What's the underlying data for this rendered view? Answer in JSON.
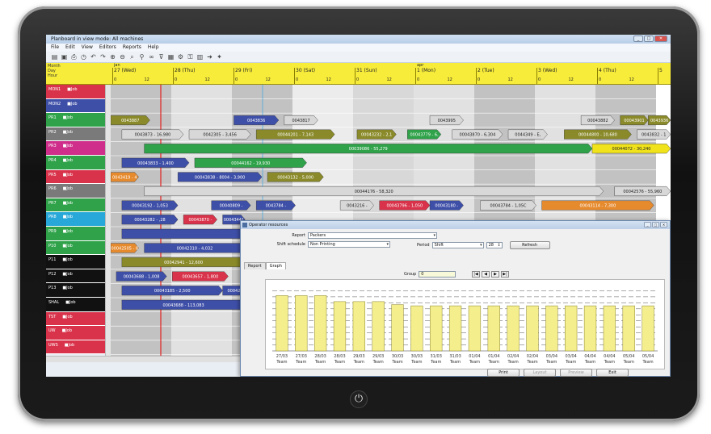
{
  "app": {
    "title": "Planboard in view mode: All machines",
    "menu": [
      "File",
      "Edit",
      "View",
      "Editors",
      "Reports",
      "Help"
    ],
    "power_icon": "power-icon"
  },
  "timeline": {
    "row_labels": [
      "Month",
      "Day",
      "Hour"
    ],
    "month_marks": [
      {
        "label": "jan"
      },
      {
        "label": "apr"
      }
    ],
    "days": [
      {
        "label": "27 (Wed)"
      },
      {
        "label": "28 (Thu)"
      },
      {
        "label": "29 (Fri)"
      },
      {
        "label": "30 (Sat)"
      },
      {
        "label": "31 (Sun)"
      },
      {
        "label": "1 (Mon)"
      },
      {
        "label": "2 (Tue)"
      },
      {
        "label": "3 (Wed)"
      },
      {
        "label": "4 (Thu)"
      },
      {
        "label": "5"
      }
    ],
    "hour_ticks": [
      "0",
      "12"
    ]
  },
  "machines": [
    {
      "name": "MON1",
      "job": "Job",
      "color": "#d9334b"
    },
    {
      "name": "MON2",
      "job": "Job",
      "color": "#3e4fa8"
    },
    {
      "name": "PR1",
      "job": "Job",
      "color": "#2fa24a"
    },
    {
      "name": "PR2",
      "job": "Job",
      "color": "#7a7a7a"
    },
    {
      "name": "PR3",
      "job": "Job",
      "color": "#cf2f8a"
    },
    {
      "name": "PR4",
      "job": "Job",
      "color": "#2fa24a"
    },
    {
      "name": "PR5",
      "job": "Job",
      "color": "#d9334b"
    },
    {
      "name": "PR6",
      "job": "Job",
      "color": "#7a7a7a"
    },
    {
      "name": "PR7",
      "job": "Job",
      "color": "#2fa24a"
    },
    {
      "name": "PR8",
      "job": "Job",
      "color": "#27a8d8"
    },
    {
      "name": "PR9",
      "job": "Job",
      "color": "#2fa24a"
    },
    {
      "name": "P10",
      "job": "Job",
      "color": "#2fa24a"
    },
    {
      "name": "P11",
      "job": "Job",
      "color": "#111111"
    },
    {
      "name": "P12",
      "job": "Job",
      "color": "#111111"
    },
    {
      "name": "P13",
      "job": "Job",
      "color": "#111111"
    },
    {
      "name": "SHAL",
      "job": "Job",
      "color": "#111111"
    },
    {
      "name": "TST",
      "job": "Job",
      "color": "#d9334b"
    },
    {
      "name": "UW",
      "job": "Job",
      "color": "#d9334b"
    },
    {
      "name": "UWS",
      "job": "Job",
      "color": "#d9334b"
    }
  ],
  "bars": [
    {
      "row": 2,
      "start": 0.0,
      "end": 0.07,
      "color": "#8a8a2a",
      "label": "0043887"
    },
    {
      "row": 2,
      "start": 0.22,
      "end": 0.3,
      "color": "#3e4fa8",
      "label": "0043836"
    },
    {
      "row": 2,
      "start": 0.31,
      "end": 0.37,
      "color": "#d8d8d8",
      "label": "0043817"
    },
    {
      "row": 2,
      "start": 0.57,
      "end": 0.63,
      "color": "#d8d8d8",
      "label": "0043995"
    },
    {
      "row": 2,
      "start": 0.84,
      "end": 0.9,
      "color": "#d8d8d8",
      "label": "00043882"
    },
    {
      "row": 2,
      "start": 0.91,
      "end": 0.96,
      "color": "#8a8a2a",
      "label": "00043901"
    },
    {
      "row": 2,
      "start": 0.96,
      "end": 1.0,
      "color": "#8a8a2a",
      "label": "0043936"
    },
    {
      "row": 3,
      "start": 0.02,
      "end": 0.13,
      "color": "#d8d8d8",
      "label": "0043873 - 16,980"
    },
    {
      "row": 3,
      "start": 0.14,
      "end": 0.25,
      "color": "#d8d8d8",
      "label": "0042305 - 3,456"
    },
    {
      "row": 3,
      "start": 0.26,
      "end": 0.4,
      "color": "#8a8a2a",
      "label": "00044201 - 7,143"
    },
    {
      "row": 3,
      "start": 0.44,
      "end": 0.51,
      "color": "#8a8a2a",
      "label": "00043232 - 2,1"
    },
    {
      "row": 3,
      "start": 0.53,
      "end": 0.59,
      "color": "#2fa24a",
      "label": "00043779 - 6,"
    },
    {
      "row": 3,
      "start": 0.61,
      "end": 0.7,
      "color": "#d8d8d8",
      "label": "00043870 - 6,304"
    },
    {
      "row": 3,
      "start": 0.71,
      "end": 0.78,
      "color": "#d8d8d8",
      "label": "0044349 - E,"
    },
    {
      "row": 3,
      "start": 0.81,
      "end": 0.93,
      "color": "#8a8a2a",
      "label": "00044800 - 10,680"
    },
    {
      "row": 3,
      "start": 0.94,
      "end": 1.0,
      "color": "#d8d8d8",
      "label": "0043832 - 1"
    },
    {
      "row": 4,
      "start": 0.06,
      "end": 0.86,
      "color": "#2fa24a",
      "label": "00039086 - 55,279"
    },
    {
      "row": 4,
      "start": 0.86,
      "end": 1.0,
      "color": "#f0e31c",
      "label": "00044072 - 30,240"
    },
    {
      "row": 5,
      "start": 0.02,
      "end": 0.14,
      "color": "#3e4fa8",
      "label": "00043833 - 1,400"
    },
    {
      "row": 5,
      "start": 0.15,
      "end": 0.35,
      "color": "#2fa24a",
      "label": "00044162 - 19,930"
    },
    {
      "row": 6,
      "start": 0.0,
      "end": 0.05,
      "color": "#e68a2e",
      "label": "0043419 - 4"
    },
    {
      "row": 6,
      "start": 0.12,
      "end": 0.27,
      "color": "#3e4fa8",
      "label": "00043838 - 8004 - 3,900"
    },
    {
      "row": 6,
      "start": 0.28,
      "end": 0.38,
      "color": "#8a8a2a",
      "label": "00043132 - 5,000"
    },
    {
      "row": 7,
      "start": 0.06,
      "end": 0.88,
      "color": "#d8d8d8",
      "label": "00044176 - 58,320"
    },
    {
      "row": 7,
      "start": 0.9,
      "end": 1.0,
      "color": "#d8d8d8",
      "label": "00042576 - 55,960"
    },
    {
      "row": 8,
      "start": 0.02,
      "end": 0.12,
      "color": "#3e4fa8",
      "label": "00043192 - 1,053"
    },
    {
      "row": 8,
      "start": 0.18,
      "end": 0.25,
      "color": "#3e4fa8",
      "label": "00040809 -"
    },
    {
      "row": 8,
      "start": 0.26,
      "end": 0.33,
      "color": "#3e4fa8",
      "label": "0043784 -"
    },
    {
      "row": 8,
      "start": 0.41,
      "end": 0.47,
      "color": "#d8d8d8",
      "label": "0043216 -"
    },
    {
      "row": 8,
      "start": 0.48,
      "end": 0.57,
      "color": "#d9334b",
      "label": "00043796 - 1,050"
    },
    {
      "row": 8,
      "start": 0.57,
      "end": 0.63,
      "color": "#3e4fa8",
      "label": "00043180 -"
    },
    {
      "row": 8,
      "start": 0.66,
      "end": 0.76,
      "color": "#d8d8d8",
      "label": "00043784 - 1,05C"
    },
    {
      "row": 8,
      "start": 0.77,
      "end": 0.97,
      "color": "#e68a2e",
      "label": "00043114 - 7,300"
    },
    {
      "row": 9,
      "start": 0.02,
      "end": 0.12,
      "color": "#3e4fa8",
      "label": "00043282 - ,28"
    },
    {
      "row": 9,
      "start": 0.13,
      "end": 0.19,
      "color": "#d9334b",
      "label": "00043870 -"
    },
    {
      "row": 9,
      "start": 0.2,
      "end": 0.24,
      "color": "#3e4fa8",
      "label": "00043441"
    },
    {
      "row": 10,
      "start": 0.02,
      "end": 0.24,
      "color": "#3e4fa8",
      "label": ""
    },
    {
      "row": 11,
      "start": 0.0,
      "end": 0.05,
      "color": "#e68a2e",
      "label": "00042505 - 8"
    },
    {
      "row": 11,
      "start": 0.06,
      "end": 0.24,
      "color": "#3e4fa8",
      "label": "00042310 - 4,032"
    },
    {
      "row": 12,
      "start": 0.02,
      "end": 0.24,
      "color": "#8a8a2a",
      "label": "00042941 - 12,600"
    },
    {
      "row": 13,
      "start": 0.01,
      "end": 0.1,
      "color": "#3e4fa8",
      "label": "00043688 - 1,008"
    },
    {
      "row": 13,
      "start": 0.11,
      "end": 0.21,
      "color": "#d9334b",
      "label": "00043657 - 1,800"
    },
    {
      "row": 14,
      "start": 0.02,
      "end": 0.2,
      "color": "#3e4fa8",
      "label": "00043185 - 2,500"
    },
    {
      "row": 14,
      "start": 0.2,
      "end": 0.24,
      "color": "#3e4fa8",
      "label": "00042"
    },
    {
      "row": 15,
      "start": 0.02,
      "end": 0.24,
      "color": "#3e4fa8",
      "label": "00043688 - 113,083"
    }
  ],
  "dialog": {
    "title": "Operator resources",
    "report_label": "Report",
    "report_value": "Packers",
    "shift_label": "Shift schedule",
    "shift_value": "Non Printing",
    "period_label": "Period",
    "period_value": "Shift",
    "period_number": "28",
    "refresh_label": "Refresh",
    "tabs": [
      "Report",
      "Graph"
    ],
    "group_label": "Group",
    "group_value": "0",
    "nav_buttons": [
      "|◀",
      "◀",
      "▶",
      "▶|"
    ],
    "buttons": {
      "print": "Print",
      "layout": "Layout",
      "preview": "Preview",
      "exit": "Exit"
    }
  },
  "chart_data": {
    "type": "bar",
    "categories": [
      "27/03",
      "27/03",
      "28/03",
      "28/03",
      "29/03",
      "29/03",
      "30/03",
      "30/03",
      "31/03",
      "31/03",
      "01/04",
      "01/04",
      "02/04",
      "02/04",
      "03/04",
      "03/04",
      "04/04",
      "04/04",
      "05/04",
      "05/04"
    ],
    "sublabel": "Team",
    "values": [
      9.2,
      9.2,
      9.2,
      8.2,
      8.2,
      8.2,
      7.7,
      7.5,
      7.5,
      7.5,
      7.5,
      7.5,
      7.5,
      7.5,
      7.5,
      7.5,
      7.5,
      7.5,
      7.5,
      7.5
    ],
    "ylim": [
      0,
      11
    ],
    "dashed_levels": [
      1,
      2,
      3,
      4,
      5,
      6,
      7,
      8,
      9,
      10
    ],
    "bar_color": "#f4ee8c"
  }
}
